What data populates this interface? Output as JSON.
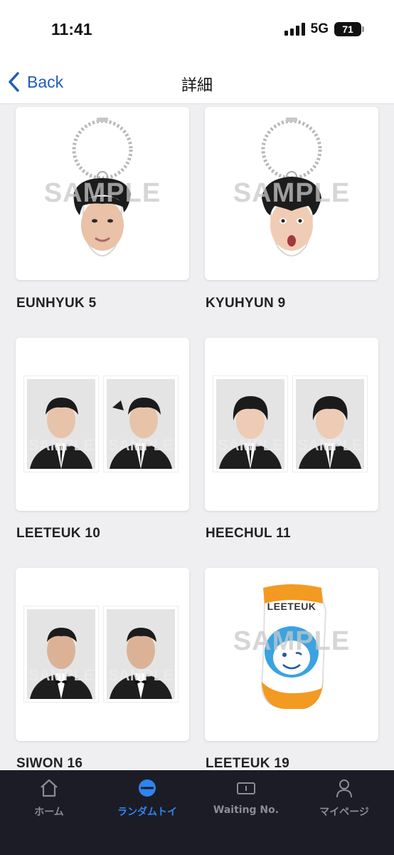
{
  "status_bar": {
    "time": "11:41",
    "network": "5G",
    "battery": "71"
  },
  "nav": {
    "back_label": "Back",
    "title": "詳細"
  },
  "watermark": "SAMPLE",
  "items": [
    {
      "label": "EUNHYUK 5",
      "type": "keychain"
    },
    {
      "label": "KYUHYUN 9",
      "type": "keychain"
    },
    {
      "label": "LEETEUK 10",
      "type": "photos"
    },
    {
      "label": "HEECHUL 11",
      "type": "photos"
    },
    {
      "label": "SIWON 16",
      "type": "photos"
    },
    {
      "label": "LEETEUK 19",
      "type": "sock",
      "sock_text": "LEETEUK"
    }
  ],
  "tabs": [
    {
      "label": "ホーム",
      "icon": "home-icon",
      "active": false
    },
    {
      "label": "ランダムトイ",
      "icon": "random-toy-icon",
      "active": true
    },
    {
      "label": "Waiting No.",
      "icon": "ticket-icon",
      "active": false
    },
    {
      "label": "マイページ",
      "icon": "person-icon",
      "active": false
    }
  ],
  "colors": {
    "accent": "#2f84f0",
    "back_link": "#1f5cbf",
    "tab_bar_bg": "#1b1c25",
    "sock_orange": "#f39a22",
    "sock_blue": "#3aa3e0"
  }
}
